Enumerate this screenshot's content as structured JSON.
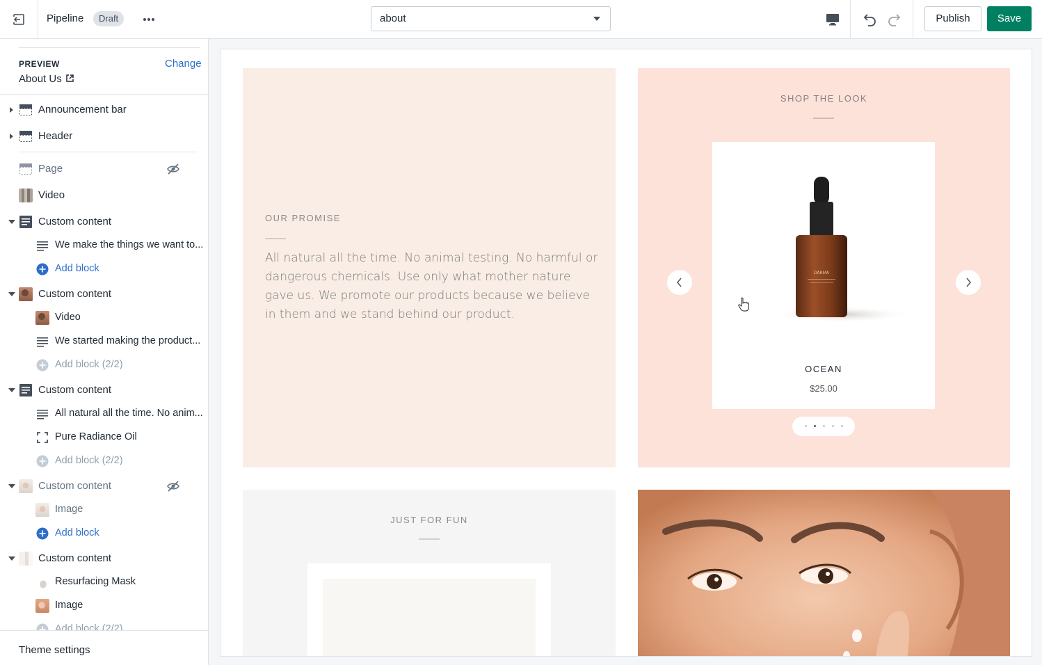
{
  "topbar": {
    "theme_name": "Pipeline",
    "status_badge": "Draft",
    "page_select_value": "about",
    "publish_label": "Publish",
    "save_label": "Save",
    "icons": [
      "exit-icon",
      "more-horizontal-icon",
      "desktop-icon",
      "undo-icon",
      "redo-icon"
    ]
  },
  "sidebar": {
    "preview": {
      "label": "PREVIEW",
      "change": "Change",
      "page": "About Us"
    },
    "sections": [
      {
        "label": "Announcement bar"
      },
      {
        "label": "Header"
      },
      {
        "label": "Page"
      },
      {
        "label": "Video"
      },
      {
        "label": "Custom content",
        "blocks": [
          "We make the things we want to...",
          "Add block"
        ]
      },
      {
        "label": "Custom content",
        "blocks": [
          "Video",
          "We started making the product...",
          "Add block (2/2)"
        ]
      },
      {
        "label": "Custom content",
        "blocks": [
          "All natural all the time. No anim...",
          "Pure Radiance Oil",
          "Add block (2/2)"
        ]
      },
      {
        "label": "Custom content",
        "blocks": [
          "Image",
          "Add block"
        ]
      },
      {
        "label": "Custom content",
        "blocks": [
          "Resurfacing Mask",
          "Image",
          "Add block (2/2)"
        ]
      }
    ],
    "footer": "Theme settings"
  },
  "canvas": {
    "promise": {
      "title": "OUR PROMISE",
      "text": "All natural all the time. No animal testing. No harmful or dangerous chemicals. Use only what mother nature gave us. We promote our products because we believe in them and we stand behind our product."
    },
    "shop": {
      "title": "SHOP THE LOOK",
      "product_name": "OCEAN",
      "product_price": "$25.00",
      "bottle_label": "DÁRMA",
      "slides": 5,
      "active_slide": 2
    },
    "fun": {
      "title": "JUST FOR FUN"
    }
  },
  "colors": {
    "accent": "#008060",
    "link": "#2c6ecb",
    "promise_bg": "#f9ede6",
    "shop_bg": "#fde2da"
  }
}
